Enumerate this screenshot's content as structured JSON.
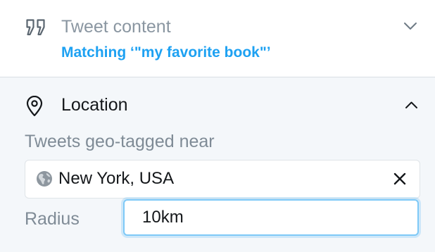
{
  "tweet_content": {
    "title": "Tweet content",
    "summary": "Matching ‘\"my favorite book\"’",
    "icon": "quote-icon",
    "toggle_icon": "chevron-down-icon"
  },
  "location": {
    "title": "Location",
    "icon": "map-pin-icon",
    "toggle_icon": "chevron-up-icon",
    "geo_label": "Tweets geo-tagged near",
    "place": {
      "value": "New York, USA",
      "icon": "globe-icon",
      "clear_icon": "close-icon"
    },
    "radius": {
      "label": "Radius",
      "value": "10km"
    }
  },
  "colors": {
    "accent": "#1da1f2",
    "focus_border": "#7ec9f7",
    "panel_background": "#f4f7fa",
    "muted_text": "#7f8b96",
    "primary_text": "#14171a"
  }
}
